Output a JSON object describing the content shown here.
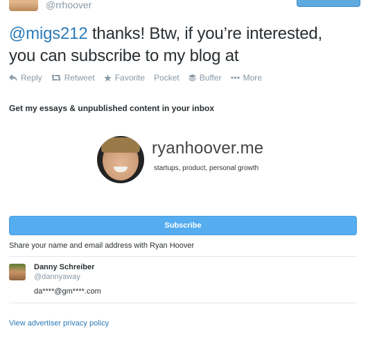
{
  "tweet": {
    "handle": "@rrhoover",
    "mention": "@migs212",
    "text_line1": " thanks! Btw, if you’re interested,",
    "text_line2": "you can subscribe to my blog at"
  },
  "actions": [
    {
      "label": "Reply",
      "icon": "reply-icon"
    },
    {
      "label": "Retweet",
      "icon": "retweet-icon"
    },
    {
      "label": "Favorite",
      "icon": "star-icon"
    },
    {
      "label": "Pocket",
      "icon": ""
    },
    {
      "label": "Buffer",
      "icon": "buffer-icon"
    },
    {
      "label": "More",
      "icon": "more-dots-icon"
    }
  ],
  "card": {
    "heading": "Get my essays & unpublished content in your inbox",
    "site_title": "ryanhoover.me",
    "tagline": "startups, product, personal growth",
    "subscribe_label": "Subscribe",
    "share_note": "Share your name and email address with Ryan Hoover"
  },
  "user": {
    "name": "Danny Schreiber",
    "handle": "@dannyaway",
    "email": "da****@gm****.com"
  },
  "footer": {
    "privacy_link": "View advertiser privacy policy"
  },
  "colors": {
    "accent": "#55acee",
    "link": "#2b7bb9",
    "muted": "#8899a6"
  }
}
